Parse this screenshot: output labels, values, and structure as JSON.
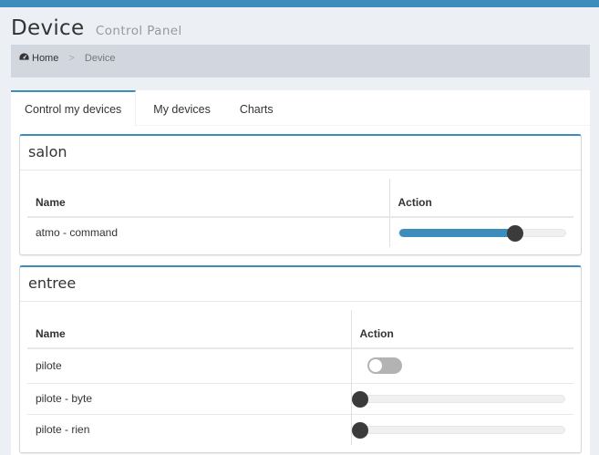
{
  "header": {
    "title": "Device",
    "subtitle": "Control Panel"
  },
  "breadcrumb": {
    "home": "Home",
    "separator": ">",
    "current": "Device"
  },
  "tabs": [
    {
      "label": "Control my devices",
      "active": true
    },
    {
      "label": "My devices",
      "active": false
    },
    {
      "label": "Charts",
      "active": false
    }
  ],
  "rooms": [
    {
      "name": "salon",
      "columns": {
        "name": "Name",
        "action": "Action"
      },
      "devices": [
        {
          "name": "atmo - command",
          "control": "slider",
          "level": 0.7
        }
      ]
    },
    {
      "name": "entree",
      "columns": {
        "name": "Name",
        "action": "Action"
      },
      "devices": [
        {
          "name": "pilote",
          "control": "toggle",
          "on": false
        },
        {
          "name": "pilote - byte",
          "control": "slider",
          "level": 0
        },
        {
          "name": "pilote - rien",
          "control": "slider",
          "level": 0
        }
      ]
    }
  ],
  "colors": {
    "accent": "#3c8dbc",
    "breadcrumb_bg": "#d2d6de",
    "page_bg": "#ecf0f5",
    "knob": "#3b3b3b"
  }
}
